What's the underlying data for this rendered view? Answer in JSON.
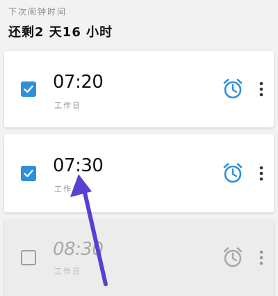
{
  "header": {
    "subtitle": "下次闹钟时间",
    "remaining": "还剩2 天16 小时"
  },
  "alarms": [
    {
      "time": "07:20",
      "repeat": "工作日",
      "enabled": true
    },
    {
      "time": "07:30",
      "repeat": "工作日",
      "enabled": true
    },
    {
      "time": "08:30",
      "repeat": "工作日",
      "enabled": false
    }
  ],
  "colors": {
    "accent": "#2f8fdb",
    "disabled_icon": "#a8a8a8",
    "arrow": "#5a3fd0"
  },
  "icons": {
    "alarm": "alarm-clock-icon",
    "more": "more-vertical-icon",
    "checkbox": "checkbox-icon"
  }
}
